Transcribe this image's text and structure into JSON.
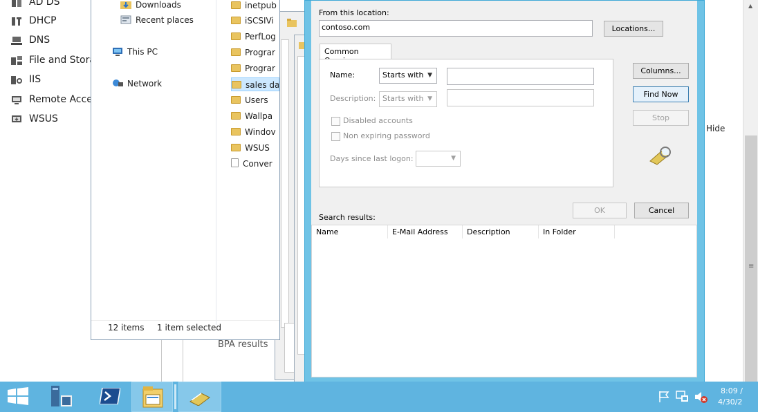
{
  "server_manager": {
    "nav_items": [
      {
        "label": "AD DS",
        "icon": "ad-ds-icon"
      },
      {
        "label": "DHCP",
        "icon": "dhcp-icon"
      },
      {
        "label": "DNS",
        "icon": "dns-icon"
      },
      {
        "label": "File and Stora",
        "icon": "file-storage-icon"
      },
      {
        "label": "IIS",
        "icon": "iis-icon"
      },
      {
        "label": "Remote Acce",
        "icon": "remote-access-icon"
      },
      {
        "label": "WSUS",
        "icon": "wsus-icon"
      }
    ],
    "hide_label": "Hide",
    "bpa_label": "BPA results"
  },
  "explorer": {
    "nav_items": [
      {
        "label": "Downloads",
        "icon": "downloads-icon"
      },
      {
        "label": "Recent places",
        "icon": "recent-places-icon"
      },
      {
        "label": "This PC",
        "icon": "this-pc-icon"
      },
      {
        "label": "Network",
        "icon": "network-icon"
      }
    ],
    "files": [
      {
        "label": "inetpub",
        "type": "folder",
        "selected": false
      },
      {
        "label": "iSCSIVi",
        "type": "folder",
        "selected": false
      },
      {
        "label": "PerfLog",
        "type": "folder",
        "selected": false
      },
      {
        "label": "Prograr",
        "type": "folder",
        "selected": false
      },
      {
        "label": "Prograr",
        "type": "folder",
        "selected": false
      },
      {
        "label": "sales da",
        "type": "folder",
        "selected": true
      },
      {
        "label": "Users",
        "type": "folder",
        "selected": false
      },
      {
        "label": "Wallpa",
        "type": "folder",
        "selected": false
      },
      {
        "label": "Windov",
        "type": "folder",
        "selected": false
      },
      {
        "label": "WSUS",
        "type": "folder",
        "selected": false
      },
      {
        "label": "Conver",
        "type": "file",
        "selected": false
      }
    ],
    "status_items": "12 items",
    "status_selected": "1 item selected"
  },
  "find_dialog": {
    "from_location_label": "From this location:",
    "location_value": "contoso.com",
    "locations_button": "Locations...",
    "tab_label": "Common Queries",
    "name_label": "Name:",
    "name_mode": "Starts with",
    "name_value": "",
    "description_label": "Description:",
    "description_mode": "Starts with",
    "description_value": "",
    "disabled_accounts_label": "Disabled accounts",
    "non_expiring_label": "Non expiring password",
    "days_since_logon_label": "Days since last logon:",
    "days_since_logon_value": "",
    "columns_button": "Columns...",
    "find_now_button": "Find Now",
    "stop_button": "Stop",
    "ok_button": "OK",
    "cancel_button": "Cancel",
    "search_results_label": "Search results:",
    "result_columns": [
      "Name",
      "E-Mail Address",
      "Description",
      "In Folder"
    ]
  },
  "taskbar": {
    "items": [
      {
        "name": "start-icon"
      },
      {
        "name": "server-manager-icon"
      },
      {
        "name": "powershell-icon"
      },
      {
        "name": "file-explorer-icon"
      },
      {
        "name": "find-users-icon"
      }
    ],
    "time": "8:09 /",
    "date": "4/30/2"
  }
}
